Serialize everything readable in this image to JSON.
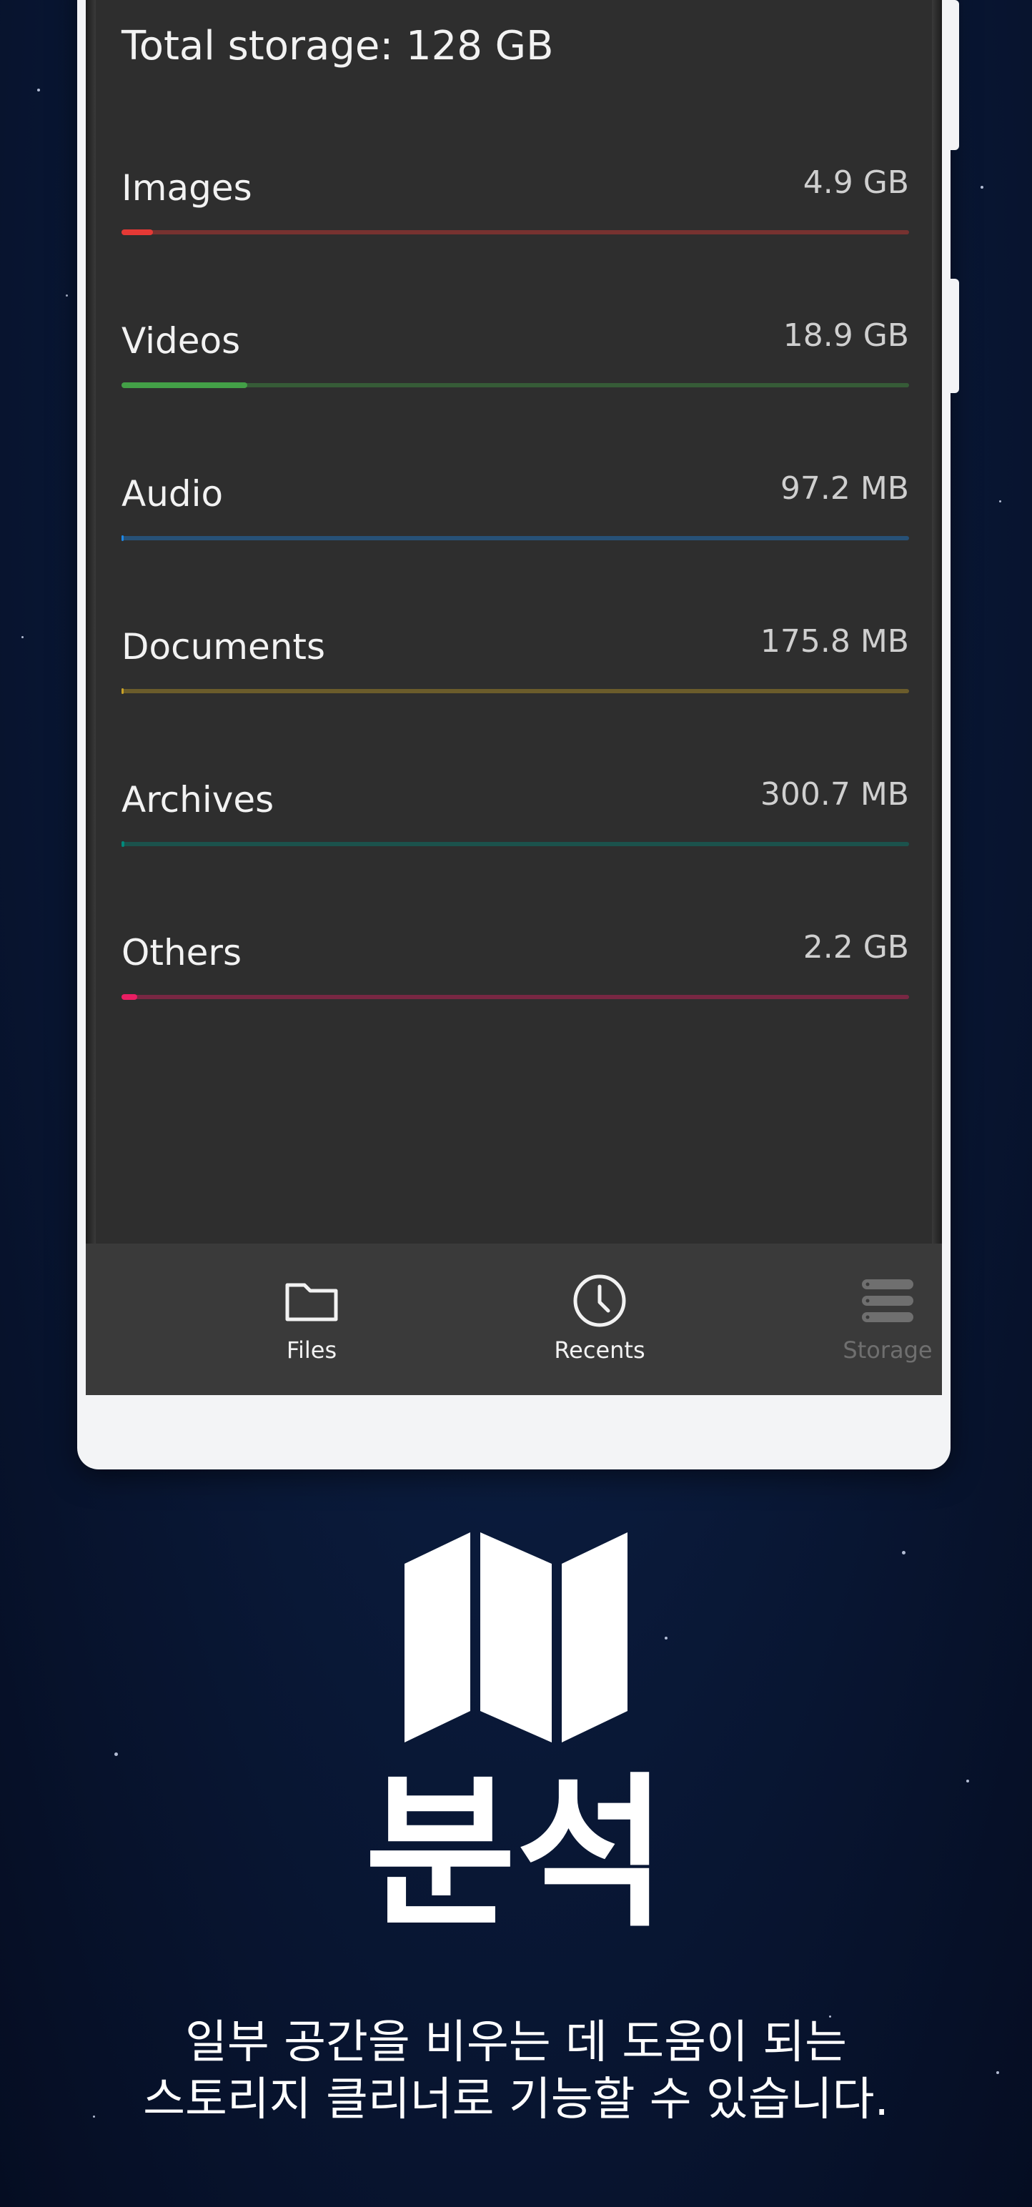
{
  "storage": {
    "total_label": "Total storage: 128 GB",
    "categories": [
      {
        "name": "Images",
        "size": "4.9 GB",
        "fraction": 0.04,
        "color": "#e53935"
      },
      {
        "name": "Videos",
        "size": "18.9 GB",
        "fraction": 0.16,
        "color": "#43a047"
      },
      {
        "name": "Audio",
        "size": "97.2 MB",
        "fraction": 0.002,
        "color": "#1e88e5"
      },
      {
        "name": "Documents",
        "size": "175.8 MB",
        "fraction": 0.003,
        "color": "#c9a227"
      },
      {
        "name": "Archives",
        "size": "300.7 MB",
        "fraction": 0.004,
        "color": "#00897b"
      },
      {
        "name": "Others",
        "size": "2.2 GB",
        "fraction": 0.02,
        "color": "#e91e63"
      }
    ]
  },
  "bottom_nav": {
    "files": "Files",
    "recents": "Recents",
    "storage": "Storage"
  },
  "icons": {
    "files": "folder-icon",
    "recents": "clock-icon",
    "storage": "storage-icon",
    "feature": "map-icon"
  },
  "promo": {
    "headline": "분석",
    "line1": "일부 공간을 비우는 데 도움이 되는",
    "line2": "스토리지 클리너로 기능할 수 있습니다."
  }
}
